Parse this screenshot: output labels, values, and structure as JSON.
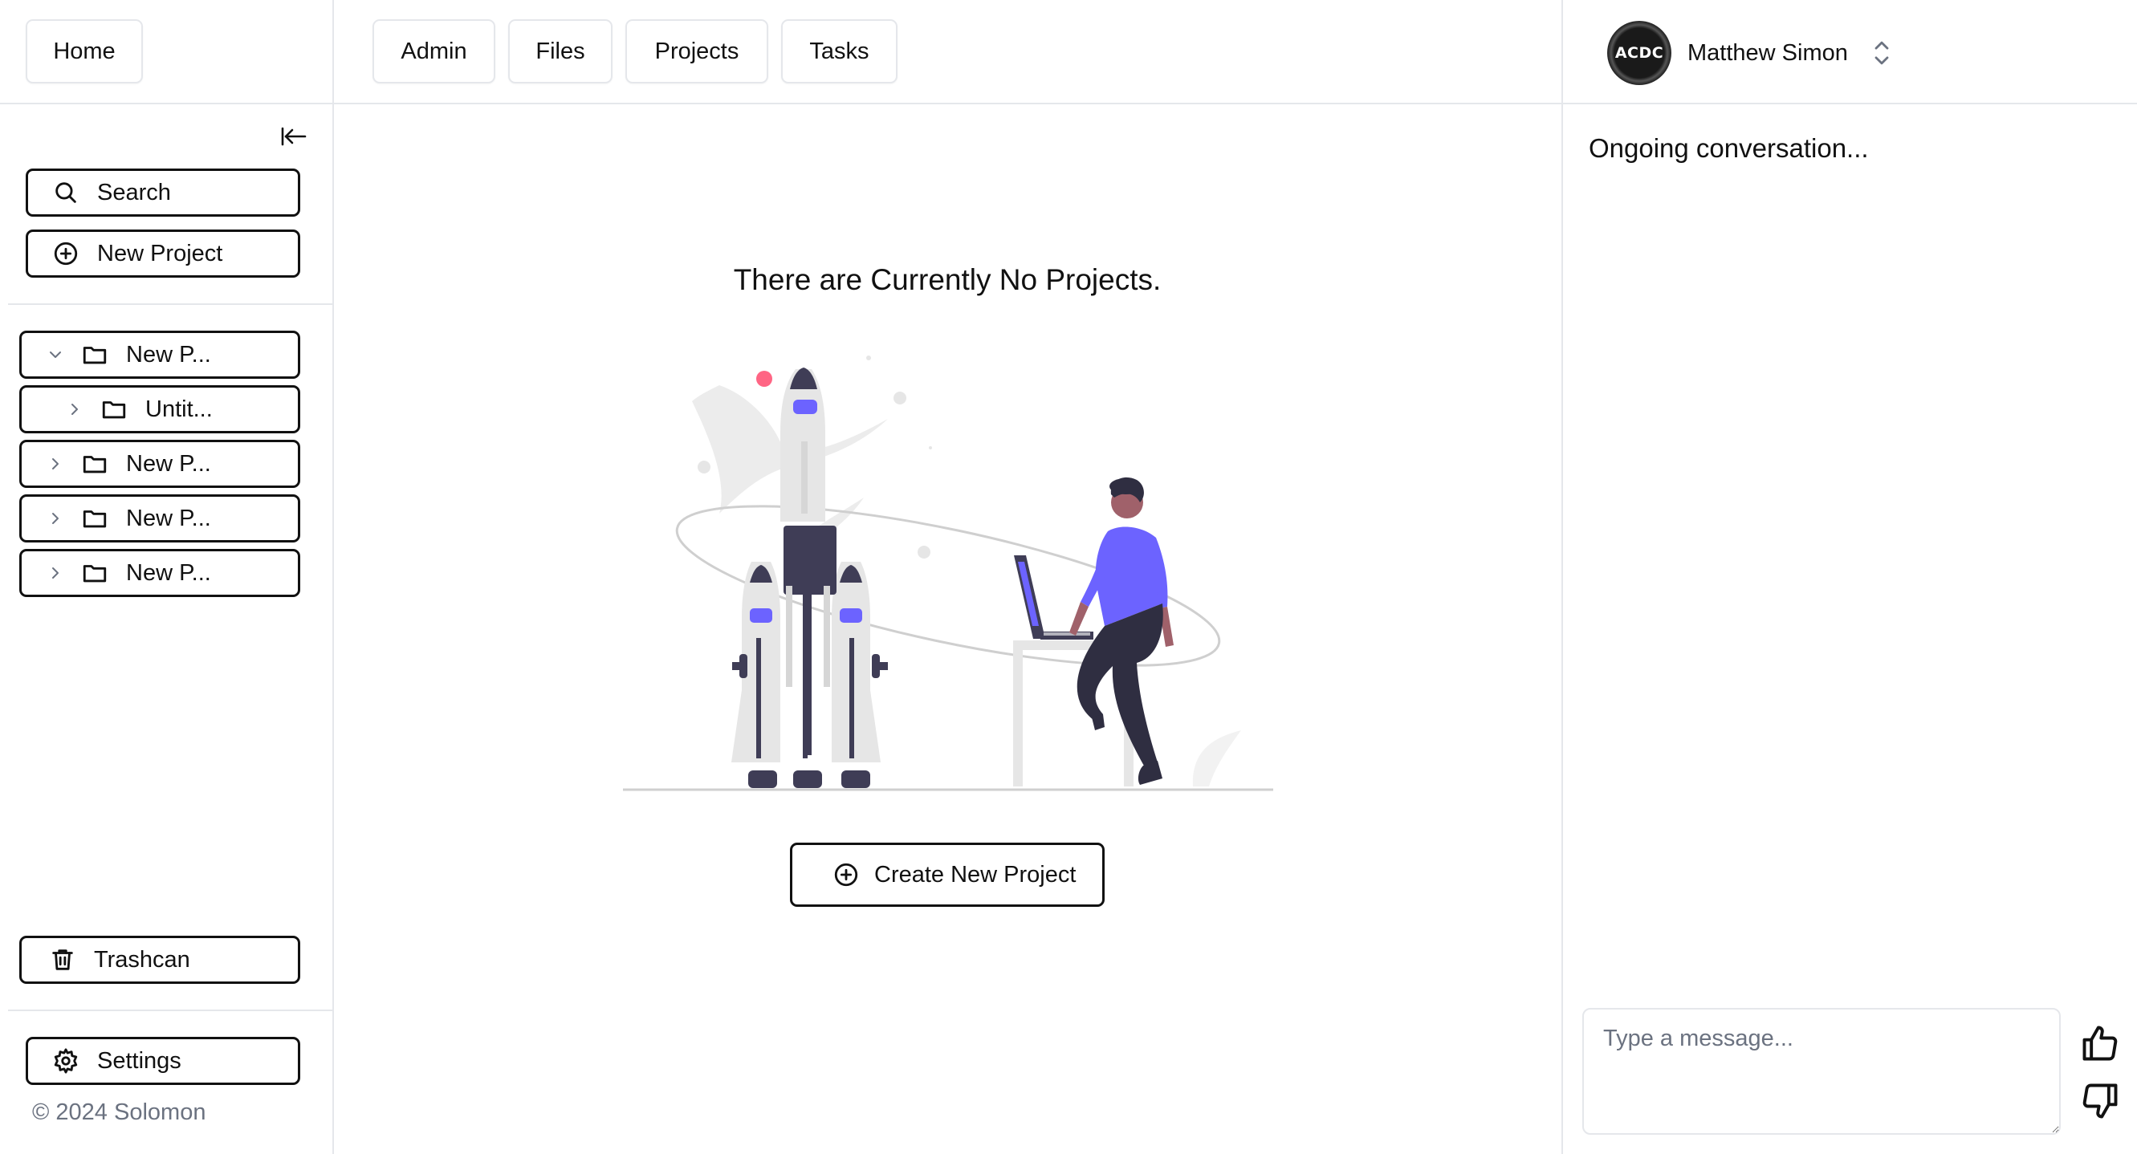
{
  "header": {
    "home_label": "Home",
    "nav_tabs": [
      {
        "label": "Admin"
      },
      {
        "label": "Files"
      },
      {
        "label": "Projects"
      },
      {
        "label": "Tasks"
      }
    ],
    "user": {
      "name": "Matthew Simon",
      "avatar_text": "ACDC"
    }
  },
  "sidebar": {
    "search_label": "Search",
    "new_project_label": "New Project",
    "tree": [
      {
        "label": "New P...",
        "expanded": true,
        "depth": 0
      },
      {
        "label": "Untit...",
        "expanded": false,
        "depth": 1
      },
      {
        "label": "New P...",
        "expanded": false,
        "depth": 0
      },
      {
        "label": "New P...",
        "expanded": false,
        "depth": 0
      },
      {
        "label": "New P...",
        "expanded": false,
        "depth": 0
      }
    ],
    "trashcan_label": "Trashcan",
    "settings_label": "Settings",
    "copyright": "© 2024 Solomon"
  },
  "main": {
    "empty_title": "There are Currently No Projects.",
    "create_label": "Create New Project"
  },
  "chat": {
    "status": "Ongoing conversation...",
    "input_placeholder": "Type a message..."
  },
  "colors": {
    "accent": "#6c63ff",
    "border": "#e5e7eb",
    "dark": "#3f3d56",
    "muted": "#6b7280"
  }
}
